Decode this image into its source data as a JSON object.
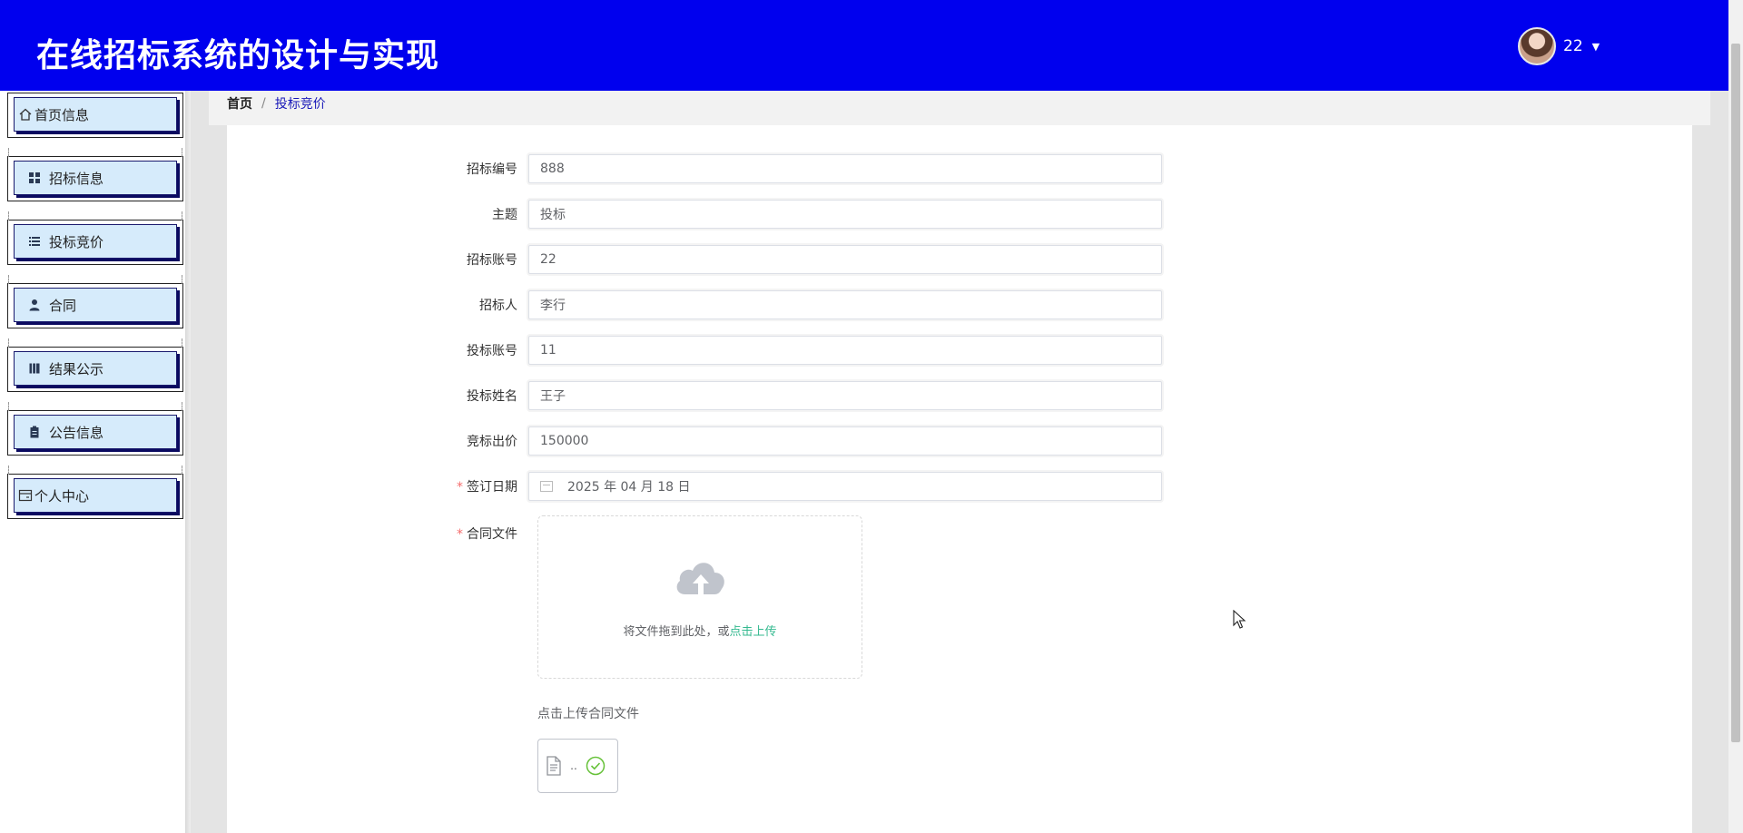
{
  "header": {
    "title": "在线招标系统的设计与实现",
    "username": "22",
    "bg_color": "#0000ee"
  },
  "sidebar": {
    "items": [
      {
        "label": "首页信息",
        "icon": "home-icon"
      },
      {
        "label": "招标信息",
        "icon": "grid-icon"
      },
      {
        "label": "投标竞价",
        "icon": "list-icon"
      },
      {
        "label": "合同",
        "icon": "user-icon"
      },
      {
        "label": "结果公示",
        "icon": "book-icon"
      },
      {
        "label": "公告信息",
        "icon": "clipboard-icon"
      },
      {
        "label": "个人中心",
        "icon": "card-icon"
      }
    ]
  },
  "breadcrumb": {
    "home": "首页",
    "separator": "/",
    "current": "投标竞价"
  },
  "form": {
    "fields": [
      {
        "label": "招标编号",
        "value": "888",
        "required": false
      },
      {
        "label": "主题",
        "value": "投标",
        "required": false
      },
      {
        "label": "招标账号",
        "value": "22",
        "required": false
      },
      {
        "label": "招标人",
        "value": "李行",
        "required": false
      },
      {
        "label": "投标账号",
        "value": "11",
        "required": false
      },
      {
        "label": "投标姓名",
        "value": "王子",
        "required": false
      },
      {
        "label": "竞标出价",
        "value": "150000",
        "required": false
      },
      {
        "label": "签订日期",
        "value": "2025 年 04 月 18 日",
        "required": true
      }
    ],
    "contract_file": {
      "label": "合同文件",
      "required_mark": "*",
      "drop_hint": "将文件拖到此处，或",
      "upload_link": "点击上传",
      "tip": "点击上传合同文件",
      "file_name": "..",
      "status": "uploaded-success",
      "accent_color": "#34b98f"
    }
  }
}
